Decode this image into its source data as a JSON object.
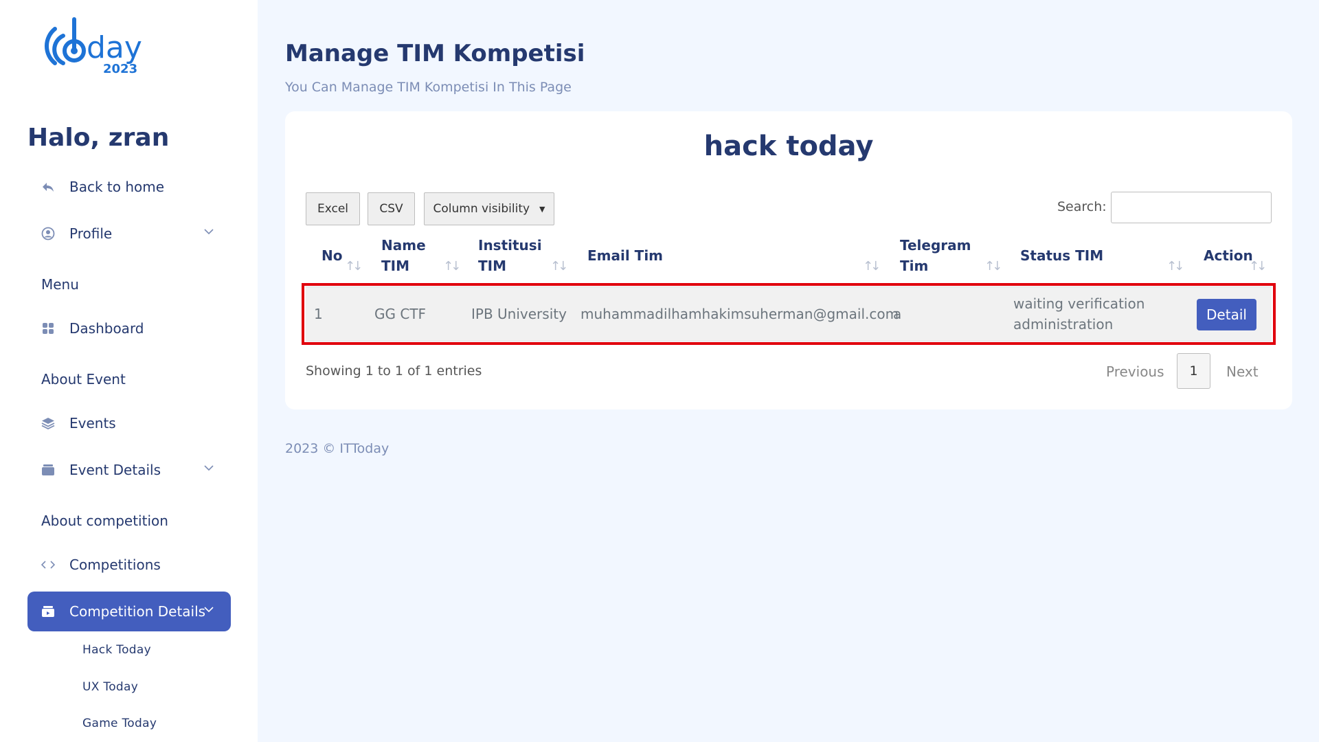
{
  "sidebar": {
    "greeting": "Halo, zran",
    "back_home": "Back to home",
    "profile": "Profile",
    "menu_title": "Menu",
    "dashboard": "Dashboard",
    "about_event_title": "About Event",
    "events": "Events",
    "event_details": "Event Details",
    "about_competition_title": "About competition",
    "competitions": "Competitions",
    "competition_details": "Competition Details",
    "sub_items": [
      "Hack Today",
      "UX Today",
      "Game Today"
    ]
  },
  "logo": {
    "year": "2023",
    "word": "day"
  },
  "header": {
    "title": "Manage TIM Kompetisi",
    "subtitle": "You Can Manage TIM Kompetisi In This Page"
  },
  "card": {
    "title": "hack today",
    "buttons": {
      "excel": "Excel",
      "csv": "CSV",
      "colvis": "Column visibility"
    },
    "search_label": "Search:",
    "search_value": "",
    "columns": {
      "no": "No",
      "name1": "Name",
      "name2": "TIM",
      "inst1": "Institusi",
      "inst2": "TIM",
      "email": "Email Tim",
      "tele1": "Telegram",
      "tele2": "Tim",
      "status": "Status TIM",
      "action": "Action"
    },
    "row": {
      "no": "1",
      "name": "GG CTF",
      "institusi": "IPB University",
      "email": "muhammadilhamhakimsuherman@gmail.com",
      "telegram": "a",
      "status1": "waiting verification",
      "status2": "administration",
      "action": "Detail"
    },
    "info": "Showing 1 to 1 of 1 entries",
    "pagination": {
      "previous": "Previous",
      "page": "1",
      "next": "Next"
    }
  },
  "footer": "2023 © ITToday",
  "colors": {
    "primary": "#435ebe",
    "text": "#25396f",
    "highlight": "#e0000d",
    "background": "#f2f7ff"
  }
}
